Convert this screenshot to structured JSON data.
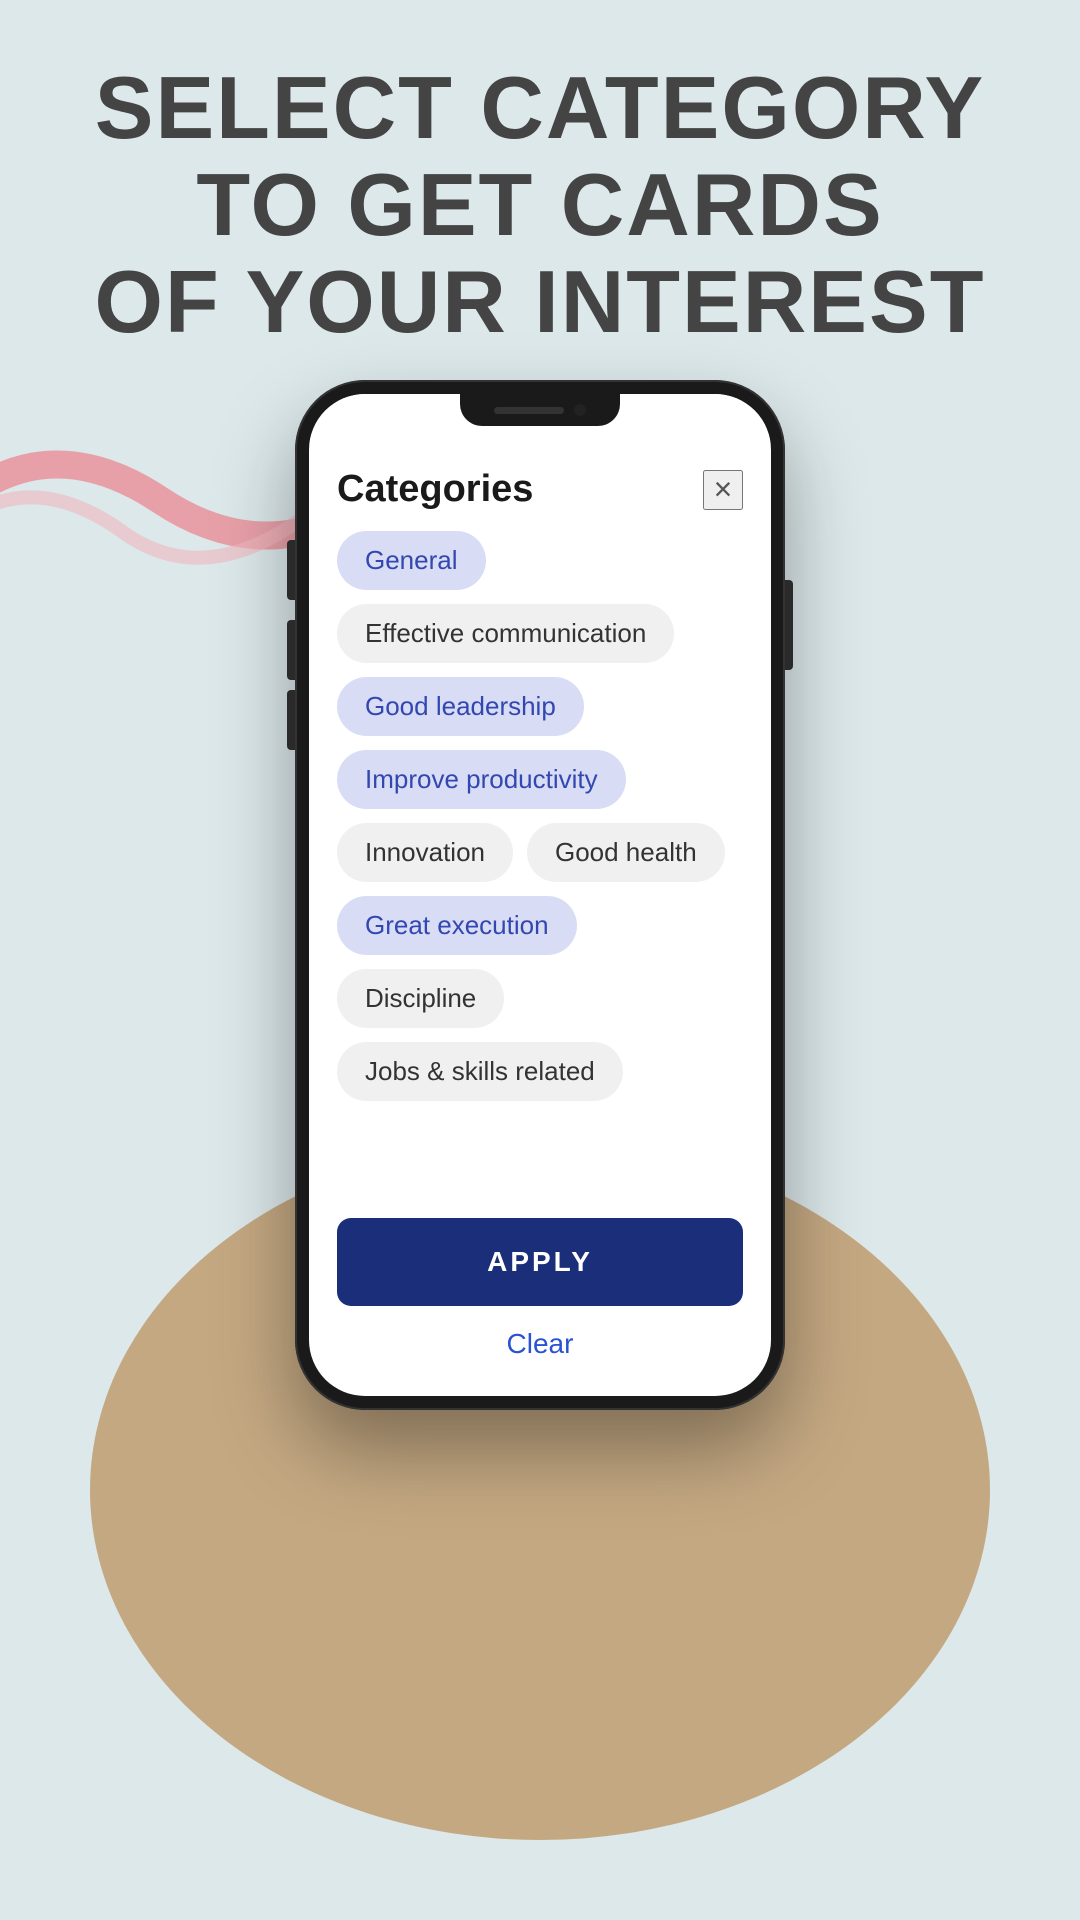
{
  "page": {
    "background_color": "#dce8ea"
  },
  "heading": {
    "line1": "Select category to get CARDs",
    "line2": "of your interest"
  },
  "modal": {
    "title": "Categories",
    "close_icon": "×",
    "apply_label": "APPLY",
    "clear_label": "Clear",
    "tags": [
      {
        "id": "general",
        "label": "General",
        "selected": true
      },
      {
        "id": "effective-communication",
        "label": "Effective communication",
        "selected": false
      },
      {
        "id": "good-leadership",
        "label": "Good leadership",
        "selected": true
      },
      {
        "id": "improve-productivity",
        "label": "Improve productivity",
        "selected": true
      },
      {
        "id": "innovation",
        "label": "Innovation",
        "selected": false
      },
      {
        "id": "good-health",
        "label": "Good health",
        "selected": false
      },
      {
        "id": "great-execution",
        "label": "Great execution",
        "selected": true
      },
      {
        "id": "discipline",
        "label": "Discipline",
        "selected": false
      },
      {
        "id": "jobs-skills",
        "label": "Jobs & skills related",
        "selected": false
      }
    ]
  }
}
